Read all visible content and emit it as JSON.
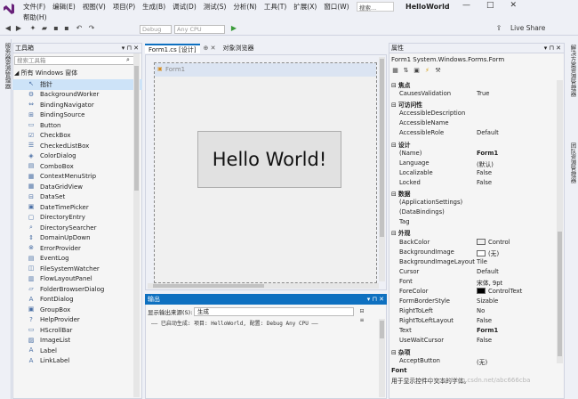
{
  "menu_row1": [
    "文件(F)",
    "编辑(E)",
    "视图(V)",
    "项目(P)",
    "生成(B)",
    "调试(D)",
    "测试(S)",
    "分析(N)",
    "工具(T)",
    "扩展(X)",
    "窗口(W)"
  ],
  "menu_row2": [
    "帮助(H)"
  ],
  "search_placeholder": "搜索...",
  "app_title": "HelloWorld",
  "window_buttons": [
    "—",
    "□",
    "✕"
  ],
  "config_combo": "Debug",
  "platform_combo": "Any CPU",
  "live_share": "Live Share",
  "left_strip_label": "服务器资源管理器",
  "toolbox": {
    "title": "工具箱",
    "pin": "▾ ⊓ ✕",
    "search_placeholder": "搜索工具箱",
    "group": "所有 Windows 窗体",
    "items": [
      {
        "icon": "pointer-icon",
        "glyph": "↖",
        "label": "指针"
      },
      {
        "icon": "worker-icon",
        "glyph": "⚙",
        "label": "BackgroundWorker"
      },
      {
        "icon": "navigator-icon",
        "glyph": "⇔",
        "label": "BindingNavigator"
      },
      {
        "icon": "source-icon",
        "glyph": "⊞",
        "label": "BindingSource"
      },
      {
        "icon": "button-icon",
        "glyph": "▭",
        "label": "Button"
      },
      {
        "icon": "checkbox-icon",
        "glyph": "☑",
        "label": "CheckBox"
      },
      {
        "icon": "checkedlistbox-icon",
        "glyph": "☰",
        "label": "CheckedListBox"
      },
      {
        "icon": "colordialog-icon",
        "glyph": "◈",
        "label": "ColorDialog"
      },
      {
        "icon": "combobox-icon",
        "glyph": "▤",
        "label": "ComboBox"
      },
      {
        "icon": "contextmenu-icon",
        "glyph": "▦",
        "label": "ContextMenuStrip"
      },
      {
        "icon": "datagridview-icon",
        "glyph": "▦",
        "label": "DataGridView"
      },
      {
        "icon": "dataset-icon",
        "glyph": "⊟",
        "label": "DataSet"
      },
      {
        "icon": "datetimepicker-icon",
        "glyph": "▣",
        "label": "DateTimePicker"
      },
      {
        "icon": "directoryentry-icon",
        "glyph": "▢",
        "label": "DirectoryEntry"
      },
      {
        "icon": "directorysearcher-icon",
        "glyph": "⌕",
        "label": "DirectorySearcher"
      },
      {
        "icon": "domainupdown-icon",
        "glyph": "⇕",
        "label": "DomainUpDown"
      },
      {
        "icon": "errorprovider-icon",
        "glyph": "⊗",
        "label": "ErrorProvider"
      },
      {
        "icon": "eventlog-icon",
        "glyph": "▤",
        "label": "EventLog"
      },
      {
        "icon": "filesystemwatcher-icon",
        "glyph": "◫",
        "label": "FileSystemWatcher"
      },
      {
        "icon": "flowlayoutpanel-icon",
        "glyph": "▥",
        "label": "FlowLayoutPanel"
      },
      {
        "icon": "folderbrowser-icon",
        "glyph": "▱",
        "label": "FolderBrowserDialog"
      },
      {
        "icon": "fontdialog-icon",
        "glyph": "A",
        "label": "FontDialog"
      },
      {
        "icon": "groupbox-icon",
        "glyph": "▣",
        "label": "GroupBox"
      },
      {
        "icon": "helpprovider-icon",
        "glyph": "?",
        "label": "HelpProvider"
      },
      {
        "icon": "hscrollbar-icon",
        "glyph": "▭",
        "label": "HScrollBar"
      },
      {
        "icon": "imagelist-icon",
        "glyph": "▨",
        "label": "ImageList"
      },
      {
        "icon": "label-icon",
        "glyph": "A",
        "label": "Label"
      },
      {
        "icon": "linklabel-icon",
        "glyph": "A",
        "label": "LinkLabel"
      }
    ]
  },
  "designer": {
    "tabs": [
      "Form1.cs [设计]",
      "⊕  ✕",
      "对象浏览器"
    ],
    "form_title": "Form1",
    "button_text": "Hello World!"
  },
  "output": {
    "title": "输出",
    "source_label": "显示输出来源(S):",
    "source_value": "生成",
    "line": "—— 已启动生成: 项目: HelloWorld, 配置: Debug Any CPU ——"
  },
  "properties": {
    "title": "属性",
    "object": "Form1 System.Windows.Forms.Form",
    "rows": [
      {
        "k": "焦点",
        "v": "",
        "cat": true
      },
      {
        "k": "CausesValidation",
        "v": "True"
      },
      {
        "k": "可访问性",
        "v": "",
        "cat": true
      },
      {
        "k": "AccessibleDescription",
        "v": ""
      },
      {
        "k": "AccessibleName",
        "v": ""
      },
      {
        "k": "AccessibleRole",
        "v": "Default"
      },
      {
        "k": "设计",
        "v": "",
        "cat": true
      },
      {
        "k": "(Name)",
        "v": "Form1",
        "bold": true
      },
      {
        "k": "Language",
        "v": "(默认)"
      },
      {
        "k": "Localizable",
        "v": "False"
      },
      {
        "k": "Locked",
        "v": "False"
      },
      {
        "k": "数据",
        "v": "",
        "cat": true
      },
      {
        "k": "(ApplicationSettings)",
        "v": ""
      },
      {
        "k": "(DataBindings)",
        "v": ""
      },
      {
        "k": "Tag",
        "v": ""
      },
      {
        "k": "外观",
        "v": "",
        "cat": true
      },
      {
        "k": "BackColor",
        "v": "Control",
        "swatch": "#f0f0f0"
      },
      {
        "k": "BackgroundImage",
        "v": "(无)",
        "swatch": "#ffffff"
      },
      {
        "k": "BackgroundImageLayout",
        "v": "Tile"
      },
      {
        "k": "Cursor",
        "v": "Default"
      },
      {
        "k": "Font",
        "v": "宋体, 9pt"
      },
      {
        "k": "ForeColor",
        "v": "ControlText",
        "swatch": "#000000"
      },
      {
        "k": "FormBorderStyle",
        "v": "Sizable"
      },
      {
        "k": "RightToLeft",
        "v": "No"
      },
      {
        "k": "RightToLeftLayout",
        "v": "False"
      },
      {
        "k": "Text",
        "v": "Form1",
        "bold": true
      },
      {
        "k": "UseWaitCursor",
        "v": "False"
      },
      {
        "k": "杂项",
        "v": "",
        "cat": true
      },
      {
        "k": "AcceptButton",
        "v": "(无)"
      }
    ],
    "desc_name": "Font",
    "desc_text": "用于显示控件中文本的字体。"
  },
  "right_strip": [
    "解决方案资源管理器",
    "团队资源管理器"
  ],
  "watermark": "https://blog.csdn.net/abc666cba",
  "colors": {
    "accent": "#0e70c0",
    "selected": "#cde3f8"
  }
}
